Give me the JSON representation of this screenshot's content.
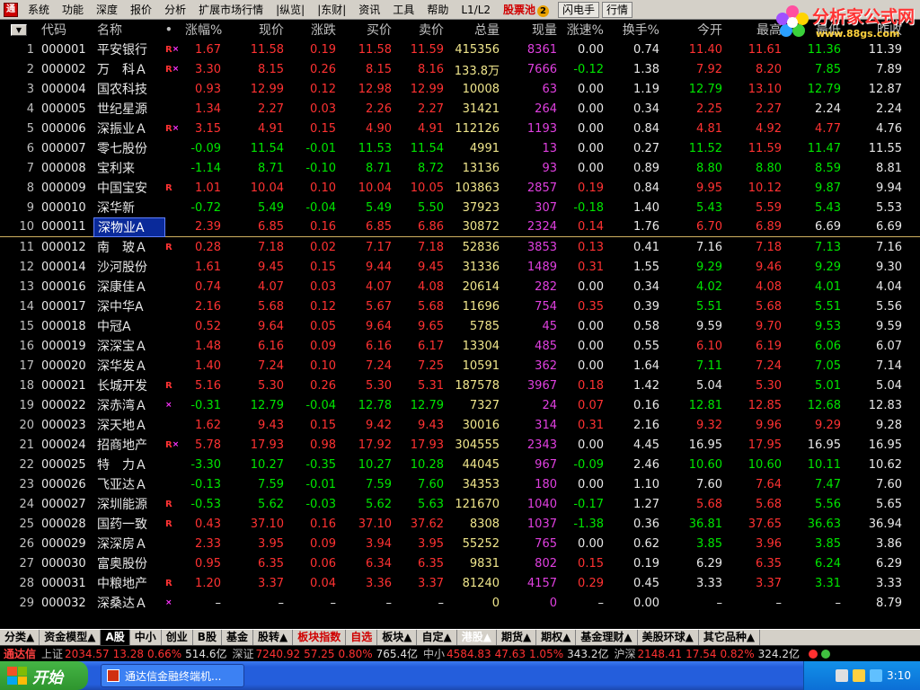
{
  "menu": {
    "items": [
      "系统",
      "功能",
      "深度",
      "报价",
      "分析",
      "扩展市场行情",
      "|纵览|",
      "|东财|",
      "资讯",
      "工具",
      "帮助",
      "L1/L2"
    ],
    "stock_pool": "股票池",
    "stock_pool_badge": "2",
    "flash_btn": "闪电手",
    "quote_btn": "行情"
  },
  "logo": {
    "title": "分析家公式网",
    "url": "www.88gs.com"
  },
  "table": {
    "headers": {
      "code": "代码",
      "name": "名称",
      "dot": "•",
      "pct": "涨幅%",
      "price": "现价",
      "chg": "涨跌",
      "bid": "买价",
      "ask": "卖价",
      "vol": "总量",
      "cur": "现量",
      "spd": "涨速%",
      "turn": "换手%",
      "open": "今开",
      "high": "最高",
      "low": "最低",
      "prev": "昨收"
    },
    "rows": [
      {
        "i": "1",
        "code": "000001",
        "name": "平安银行",
        "flag": "R",
        "x": "×",
        "pct": "1.67",
        "price": "11.58",
        "chg": "0.19",
        "bid": "11.58",
        "ask": "11.59",
        "vol": "415356",
        "cur": "8361",
        "spd": "0.00",
        "turn": "0.74",
        "open": "11.40",
        "high": "11.61",
        "low": "11.36",
        "prev": "11.39",
        "d": "up",
        "od": "up",
        "hd": "up",
        "ld": "dn"
      },
      {
        "i": "2",
        "code": "000002",
        "name": "万　科Ａ",
        "flag": "R",
        "x": "×",
        "pct": "3.30",
        "price": "8.15",
        "chg": "0.26",
        "bid": "8.15",
        "ask": "8.16",
        "vol": "133.8万",
        "cur": "7666",
        "spd": "-0.12",
        "turn": "1.38",
        "open": "7.92",
        "high": "8.20",
        "low": "7.85",
        "prev": "7.89",
        "d": "up",
        "od": "up",
        "hd": "up",
        "ld": "dn"
      },
      {
        "i": "3",
        "code": "000004",
        "name": "国农科技",
        "flag": "",
        "x": "",
        "pct": "0.93",
        "price": "12.99",
        "chg": "0.12",
        "bid": "12.98",
        "ask": "12.99",
        "vol": "10008",
        "cur": "63",
        "spd": "0.00",
        "turn": "1.19",
        "open": "12.79",
        "high": "13.10",
        "low": "12.79",
        "prev": "12.87",
        "d": "up",
        "od": "dn",
        "hd": "up",
        "ld": "dn"
      },
      {
        "i": "4",
        "code": "000005",
        "name": "世纪星源",
        "flag": "",
        "x": "",
        "pct": "1.34",
        "price": "2.27",
        "chg": "0.03",
        "bid": "2.26",
        "ask": "2.27",
        "vol": "31421",
        "cur": "264",
        "spd": "0.00",
        "turn": "0.34",
        "open": "2.25",
        "high": "2.27",
        "low": "2.24",
        "prev": "2.24",
        "d": "up",
        "od": "up",
        "hd": "up",
        "ld": "eq"
      },
      {
        "i": "5",
        "code": "000006",
        "name": "深振业Ａ",
        "flag": "R",
        "x": "×",
        "pct": "3.15",
        "price": "4.91",
        "chg": "0.15",
        "bid": "4.90",
        "ask": "4.91",
        "vol": "112126",
        "cur": "1193",
        "spd": "0.00",
        "turn": "0.84",
        "open": "4.81",
        "high": "4.92",
        "low": "4.77",
        "prev": "4.76",
        "d": "up",
        "od": "up",
        "hd": "up",
        "ld": "up"
      },
      {
        "i": "6",
        "code": "000007",
        "name": "零七股份",
        "flag": "",
        "x": "",
        "pct": "-0.09",
        "price": "11.54",
        "chg": "-0.01",
        "bid": "11.53",
        "ask": "11.54",
        "vol": "4991",
        "cur": "13",
        "spd": "0.00",
        "turn": "0.27",
        "open": "11.52",
        "high": "11.59",
        "low": "11.47",
        "prev": "11.55",
        "d": "dn",
        "od": "dn",
        "hd": "up",
        "ld": "dn"
      },
      {
        "i": "7",
        "code": "000008",
        "name": "宝利来",
        "flag": "",
        "x": "",
        "pct": "-1.14",
        "price": "8.71",
        "chg": "-0.10",
        "bid": "8.71",
        "ask": "8.72",
        "vol": "13136",
        "cur": "93",
        "spd": "0.00",
        "turn": "0.89",
        "open": "8.80",
        "high": "8.80",
        "low": "8.59",
        "prev": "8.81",
        "d": "dn",
        "od": "dn",
        "hd": "dn",
        "ld": "dn"
      },
      {
        "i": "8",
        "code": "000009",
        "name": "中国宝安",
        "flag": "R",
        "x": "",
        "pct": "1.01",
        "price": "10.04",
        "chg": "0.10",
        "bid": "10.04",
        "ask": "10.05",
        "vol": "103863",
        "cur": "2857",
        "spd": "0.19",
        "turn": "0.84",
        "open": "9.95",
        "high": "10.12",
        "low": "9.87",
        "prev": "9.94",
        "d": "up",
        "od": "up",
        "hd": "up",
        "ld": "dn"
      },
      {
        "i": "9",
        "code": "000010",
        "name": "深华新",
        "flag": "",
        "x": "",
        "pct": "-0.72",
        "price": "5.49",
        "chg": "-0.04",
        "bid": "5.49",
        "ask": "5.50",
        "vol": "37923",
        "cur": "307",
        "spd": "-0.18",
        "turn": "1.40",
        "open": "5.43",
        "high": "5.59",
        "low": "5.43",
        "prev": "5.53",
        "d": "dn",
        "od": "dn",
        "hd": "up",
        "ld": "dn"
      },
      {
        "i": "10",
        "code": "000011",
        "name": "深物业A",
        "flag": "",
        "x": "",
        "pct": "2.39",
        "price": "6.85",
        "chg": "0.16",
        "bid": "6.85",
        "ask": "6.86",
        "vol": "30872",
        "cur": "2324",
        "spd": "0.14",
        "turn": "1.76",
        "open": "6.70",
        "high": "6.89",
        "low": "6.69",
        "prev": "6.69",
        "d": "up",
        "od": "up",
        "hd": "up",
        "ld": "eq",
        "hl": true
      },
      {
        "i": "11",
        "code": "000012",
        "name": "南　玻Ａ",
        "flag": "R",
        "x": "",
        "pct": "0.28",
        "price": "7.18",
        "chg": "0.02",
        "bid": "7.17",
        "ask": "7.18",
        "vol": "52836",
        "cur": "3853",
        "spd": "0.13",
        "turn": "0.41",
        "open": "7.16",
        "high": "7.18",
        "low": "7.13",
        "prev": "7.16",
        "d": "up",
        "od": "eq",
        "hd": "up",
        "ld": "dn"
      },
      {
        "i": "12",
        "code": "000014",
        "name": "沙河股份",
        "flag": "",
        "x": "",
        "pct": "1.61",
        "price": "9.45",
        "chg": "0.15",
        "bid": "9.44",
        "ask": "9.45",
        "vol": "31336",
        "cur": "1489",
        "spd": "0.31",
        "turn": "1.55",
        "open": "9.29",
        "high": "9.46",
        "low": "9.29",
        "prev": "9.30",
        "d": "up",
        "od": "dn",
        "hd": "up",
        "ld": "dn"
      },
      {
        "i": "13",
        "code": "000016",
        "name": "深康佳Ａ",
        "flag": "",
        "x": "",
        "pct": "0.74",
        "price": "4.07",
        "chg": "0.03",
        "bid": "4.07",
        "ask": "4.08",
        "vol": "20614",
        "cur": "282",
        "spd": "0.00",
        "turn": "0.34",
        "open": "4.02",
        "high": "4.08",
        "low": "4.01",
        "prev": "4.04",
        "d": "up",
        "od": "dn",
        "hd": "up",
        "ld": "dn"
      },
      {
        "i": "14",
        "code": "000017",
        "name": "深中华A",
        "flag": "",
        "x": "",
        "pct": "2.16",
        "price": "5.68",
        "chg": "0.12",
        "bid": "5.67",
        "ask": "5.68",
        "vol": "11696",
        "cur": "754",
        "spd": "0.35",
        "turn": "0.39",
        "open": "5.51",
        "high": "5.68",
        "low": "5.51",
        "prev": "5.56",
        "d": "up",
        "od": "dn",
        "hd": "up",
        "ld": "dn"
      },
      {
        "i": "15",
        "code": "000018",
        "name": "中冠A",
        "flag": "",
        "x": "",
        "pct": "0.52",
        "price": "9.64",
        "chg": "0.05",
        "bid": "9.64",
        "ask": "9.65",
        "vol": "5785",
        "cur": "45",
        "spd": "0.00",
        "turn": "0.58",
        "open": "9.59",
        "high": "9.70",
        "low": "9.53",
        "prev": "9.59",
        "d": "up",
        "od": "eq",
        "hd": "up",
        "ld": "dn"
      },
      {
        "i": "16",
        "code": "000019",
        "name": "深深宝Ａ",
        "flag": "",
        "x": "",
        "pct": "1.48",
        "price": "6.16",
        "chg": "0.09",
        "bid": "6.16",
        "ask": "6.17",
        "vol": "13304",
        "cur": "485",
        "spd": "0.00",
        "turn": "0.55",
        "open": "6.10",
        "high": "6.19",
        "low": "6.06",
        "prev": "6.07",
        "d": "up",
        "od": "up",
        "hd": "up",
        "ld": "dn"
      },
      {
        "i": "17",
        "code": "000020",
        "name": "深华发Ａ",
        "flag": "",
        "x": "",
        "pct": "1.40",
        "price": "7.24",
        "chg": "0.10",
        "bid": "7.24",
        "ask": "7.25",
        "vol": "10591",
        "cur": "362",
        "spd": "0.00",
        "turn": "1.64",
        "open": "7.11",
        "high": "7.24",
        "low": "7.05",
        "prev": "7.14",
        "d": "up",
        "od": "dn",
        "hd": "up",
        "ld": "dn"
      },
      {
        "i": "18",
        "code": "000021",
        "name": "长城开发",
        "flag": "R",
        "x": "",
        "pct": "5.16",
        "price": "5.30",
        "chg": "0.26",
        "bid": "5.30",
        "ask": "5.31",
        "vol": "187578",
        "cur": "3967",
        "spd": "0.18",
        "turn": "1.42",
        "open": "5.04",
        "high": "5.30",
        "low": "5.01",
        "prev": "5.04",
        "d": "up",
        "od": "eq",
        "hd": "up",
        "ld": "dn"
      },
      {
        "i": "19",
        "code": "000022",
        "name": "深赤湾Ａ",
        "flag": "",
        "x": "×",
        "pct": "-0.31",
        "price": "12.79",
        "chg": "-0.04",
        "bid": "12.78",
        "ask": "12.79",
        "vol": "7327",
        "cur": "24",
        "spd": "0.07",
        "turn": "0.16",
        "open": "12.81",
        "high": "12.85",
        "low": "12.68",
        "prev": "12.83",
        "d": "dn",
        "od": "dn",
        "hd": "up",
        "ld": "dn"
      },
      {
        "i": "20",
        "code": "000023",
        "name": "深天地Ａ",
        "flag": "",
        "x": "",
        "pct": "1.62",
        "price": "9.43",
        "chg": "0.15",
        "bid": "9.42",
        "ask": "9.43",
        "vol": "30016",
        "cur": "314",
        "spd": "0.31",
        "turn": "2.16",
        "open": "9.32",
        "high": "9.96",
        "low": "9.29",
        "prev": "9.28",
        "d": "up",
        "od": "up",
        "hd": "up",
        "ld": "up"
      },
      {
        "i": "21",
        "code": "000024",
        "name": "招商地产",
        "flag": "R",
        "x": "×",
        "pct": "5.78",
        "price": "17.93",
        "chg": "0.98",
        "bid": "17.92",
        "ask": "17.93",
        "vol": "304555",
        "cur": "2343",
        "spd": "0.00",
        "turn": "4.45",
        "open": "16.95",
        "high": "17.95",
        "low": "16.95",
        "prev": "16.95",
        "d": "up",
        "od": "eq",
        "hd": "up",
        "ld": "eq"
      },
      {
        "i": "22",
        "code": "000025",
        "name": "特　力Ａ",
        "flag": "",
        "x": "",
        "pct": "-3.30",
        "price": "10.27",
        "chg": "-0.35",
        "bid": "10.27",
        "ask": "10.28",
        "vol": "44045",
        "cur": "967",
        "spd": "-0.09",
        "turn": "2.46",
        "open": "10.60",
        "high": "10.60",
        "low": "10.11",
        "prev": "10.62",
        "d": "dn",
        "od": "dn",
        "hd": "dn",
        "ld": "dn"
      },
      {
        "i": "23",
        "code": "000026",
        "name": "飞亚达Ａ",
        "flag": "",
        "x": "",
        "pct": "-0.13",
        "price": "7.59",
        "chg": "-0.01",
        "bid": "7.59",
        "ask": "7.60",
        "vol": "34353",
        "cur": "180",
        "spd": "0.00",
        "turn": "1.10",
        "open": "7.60",
        "high": "7.64",
        "low": "7.47",
        "prev": "7.60",
        "d": "dn",
        "od": "eq",
        "hd": "up",
        "ld": "dn"
      },
      {
        "i": "24",
        "code": "000027",
        "name": "深圳能源",
        "flag": "R",
        "x": "",
        "pct": "-0.53",
        "price": "5.62",
        "chg": "-0.03",
        "bid": "5.62",
        "ask": "5.63",
        "vol": "121670",
        "cur": "1040",
        "spd": "-0.17",
        "turn": "1.27",
        "open": "5.68",
        "high": "5.68",
        "low": "5.56",
        "prev": "5.65",
        "d": "dn",
        "od": "up",
        "hd": "up",
        "ld": "dn"
      },
      {
        "i": "25",
        "code": "000028",
        "name": "国药一致",
        "flag": "R",
        "x": "",
        "pct": "0.43",
        "price": "37.10",
        "chg": "0.16",
        "bid": "37.10",
        "ask": "37.62",
        "vol": "8308",
        "cur": "1037",
        "spd": "-1.38",
        "turn": "0.36",
        "open": "36.81",
        "high": "37.65",
        "low": "36.63",
        "prev": "36.94",
        "d": "up",
        "od": "dn",
        "hd": "up",
        "ld": "dn"
      },
      {
        "i": "26",
        "code": "000029",
        "name": "深深房Ａ",
        "flag": "",
        "x": "",
        "pct": "2.33",
        "price": "3.95",
        "chg": "0.09",
        "bid": "3.94",
        "ask": "3.95",
        "vol": "55252",
        "cur": "765",
        "spd": "0.00",
        "turn": "0.62",
        "open": "3.85",
        "high": "3.96",
        "low": "3.85",
        "prev": "3.86",
        "d": "up",
        "od": "dn",
        "hd": "up",
        "ld": "dn"
      },
      {
        "i": "27",
        "code": "000030",
        "name": "富奥股份",
        "flag": "",
        "x": "",
        "pct": "0.95",
        "price": "6.35",
        "chg": "0.06",
        "bid": "6.34",
        "ask": "6.35",
        "vol": "9831",
        "cur": "802",
        "spd": "0.15",
        "turn": "0.19",
        "open": "6.29",
        "high": "6.35",
        "low": "6.24",
        "prev": "6.29",
        "d": "up",
        "od": "eq",
        "hd": "up",
        "ld": "dn"
      },
      {
        "i": "28",
        "code": "000031",
        "name": "中粮地产",
        "flag": "R",
        "x": "",
        "pct": "1.20",
        "price": "3.37",
        "chg": "0.04",
        "bid": "3.36",
        "ask": "3.37",
        "vol": "81240",
        "cur": "4157",
        "spd": "0.29",
        "turn": "0.45",
        "open": "3.33",
        "high": "3.37",
        "low": "3.31",
        "prev": "3.33",
        "d": "up",
        "od": "eq",
        "hd": "up",
        "ld": "dn"
      },
      {
        "i": "29",
        "code": "000032",
        "name": "深桑达Ａ",
        "flag": "",
        "x": "×",
        "pct": "–",
        "price": "–",
        "chg": "–",
        "bid": "–",
        "ask": "–",
        "vol": "0",
        "cur": "0",
        "spd": "–",
        "turn": "0.00",
        "open": "–",
        "high": "–",
        "low": "–",
        "prev": "8.79",
        "d": "eq",
        "od": "eq",
        "hd": "eq",
        "ld": "eq"
      }
    ]
  },
  "tabs": [
    {
      "label": "分类▲",
      "style": "normal"
    },
    {
      "label": "资金模型▲",
      "style": "normal"
    },
    {
      "label": "A股",
      "style": "active"
    },
    {
      "label": "中小",
      "style": "normal"
    },
    {
      "label": "创业",
      "style": "normal"
    },
    {
      "label": "B股",
      "style": "normal"
    },
    {
      "label": "基金",
      "style": "normal"
    },
    {
      "label": "股转▲",
      "style": "normal"
    },
    {
      "label": "板块指数",
      "style": "red"
    },
    {
      "label": "自选",
      "style": "red"
    },
    {
      "label": "板块▲",
      "style": "normal"
    },
    {
      "label": "自定▲",
      "style": "normal"
    },
    {
      "label": "港股▲",
      "style": "white"
    },
    {
      "label": "期货▲",
      "style": "normal"
    },
    {
      "label": "期权▲",
      "style": "normal"
    },
    {
      "label": "基金理财▲",
      "style": "normal"
    },
    {
      "label": "美股环球▲",
      "style": "normal"
    },
    {
      "label": "其它品种▲",
      "style": "normal"
    }
  ],
  "status": {
    "brand": "通达信",
    "sh_label": "上证",
    "sh_val": "2034.57",
    "sh_chg": "13.28",
    "sh_pct": "0.66%",
    "sh_amt": "514.6亿",
    "sz_label": "深证",
    "sz_val": "7240.92",
    "sz_chg": "57.25",
    "sz_pct": "0.80%",
    "sz_amt": "765.4亿",
    "zx_label": "中小",
    "zx_val": "4584.83",
    "zx_chg": "47.63",
    "zx_pct": "1.05%",
    "zx_amt": "343.2亿",
    "hs_label": "沪深",
    "hs_val": "2148.41",
    "hs_chg": "17.54",
    "hs_pct": "0.82%",
    "hs_amt": "324.2亿"
  },
  "taskbar": {
    "start": "开始",
    "task": "通达信金融终端机...",
    "time": "3:10"
  }
}
